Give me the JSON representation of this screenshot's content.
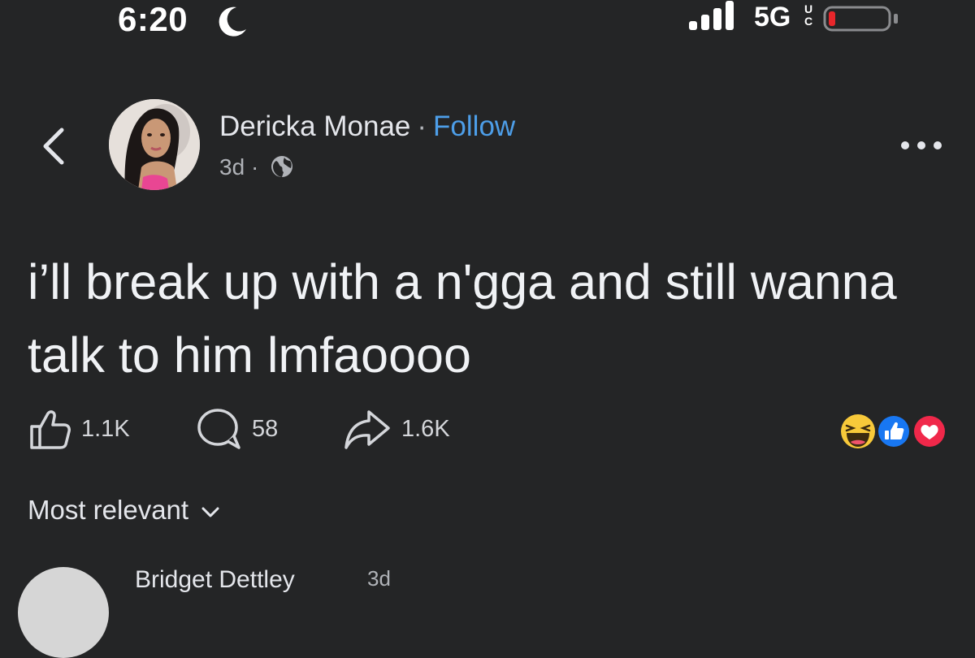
{
  "status_bar": {
    "time": "6:20",
    "network": "5G",
    "network_superscript": "UC",
    "battery_level": 0.08,
    "signal_bars": 4,
    "colors": {
      "battery_low": "#e8262b"
    }
  },
  "post": {
    "author": "Dericka Monae",
    "separator": "·",
    "follow_label": "Follow",
    "age": "3d",
    "meta_separator": "·",
    "audience_icon": "globe-icon",
    "text": "i’ll break up with a n'gga and still wanna talk to him lmfaoooo",
    "actions": {
      "like_count": "1.1K",
      "comment_count": "58",
      "share_count": "1.6K"
    },
    "reactions": [
      "haha-icon",
      "like-icon",
      "love-icon"
    ]
  },
  "comments": {
    "sort_label": "Most relevant",
    "first_comment": {
      "author": "Bridget Dettley",
      "age": "3d"
    }
  },
  "colors": {
    "background": "#242526",
    "accent": "#4d9ee8",
    "text": "#e4e6eb",
    "secondary_text": "#b0b3b8"
  }
}
